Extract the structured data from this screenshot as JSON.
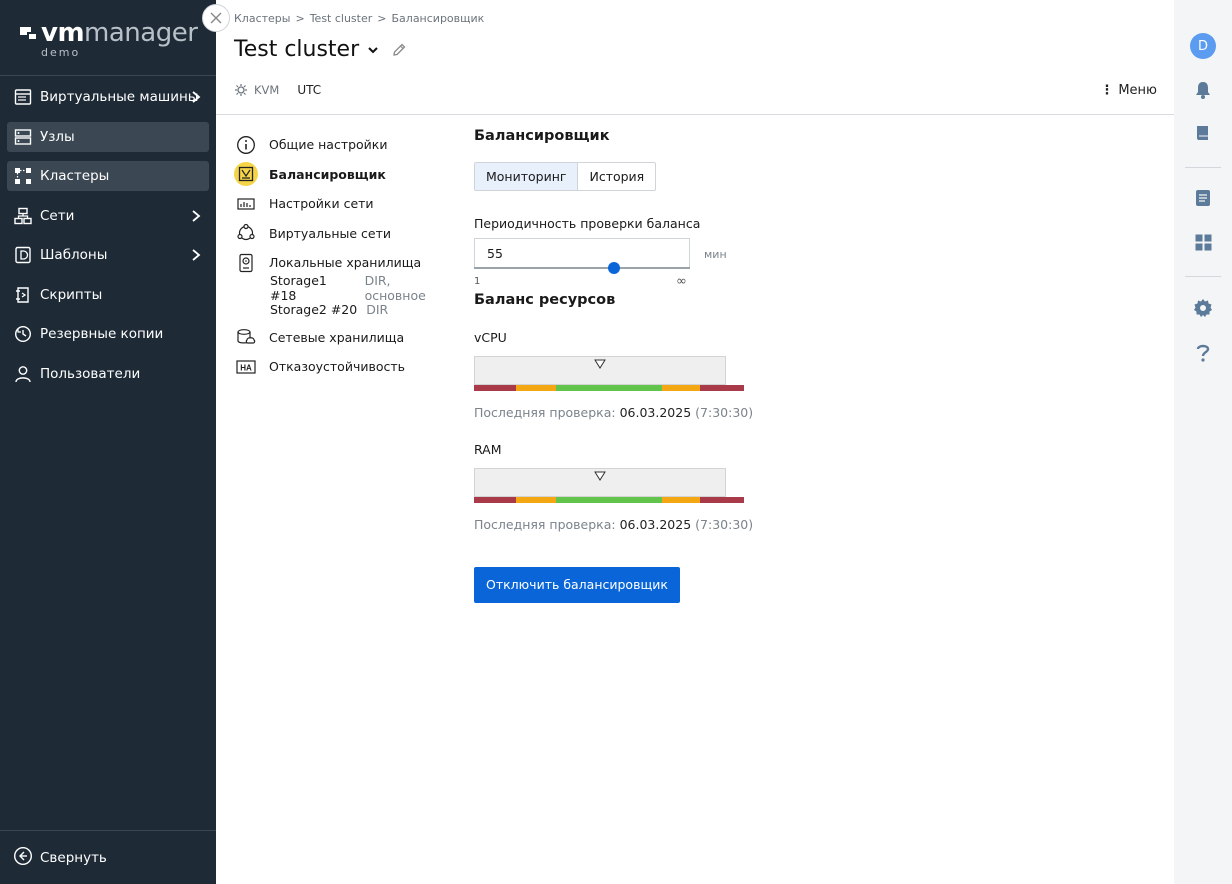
{
  "brand": {
    "vm": "vm",
    "manager": "manager",
    "subtitle": "demo"
  },
  "sidebar": {
    "items": [
      {
        "label": "Виртуальные машины",
        "icon": "vm-icon",
        "has_submenu": true,
        "active": false
      },
      {
        "label": "Узлы",
        "icon": "nodes-icon",
        "has_submenu": false,
        "active": true
      },
      {
        "label": "Кластеры",
        "icon": "clusters-icon",
        "has_submenu": false,
        "active": true
      },
      {
        "label": "Сети",
        "icon": "networks-icon",
        "has_submenu": true,
        "active": false
      },
      {
        "label": "Шаблоны",
        "icon": "templates-icon",
        "has_submenu": true,
        "active": false
      },
      {
        "label": "Скрипты",
        "icon": "scripts-icon",
        "has_submenu": false,
        "active": false
      },
      {
        "label": "Резервные копии",
        "icon": "backups-icon",
        "has_submenu": false,
        "active": false
      },
      {
        "label": "Пользователи",
        "icon": "users-icon",
        "has_submenu": false,
        "active": false
      }
    ],
    "collapse_label": "Свернуть"
  },
  "breadcrumb": [
    "Кластеры",
    "Test cluster",
    "Балансировщик"
  ],
  "breadcrumb_sep": ">",
  "header": {
    "title": "Test cluster",
    "virt_type": "KVM",
    "timezone": "UTC",
    "menu_label": "Меню"
  },
  "subnav": {
    "items": [
      {
        "label": "Общие настройки",
        "icon": "info-icon",
        "active": false
      },
      {
        "label": "Балансировщик",
        "icon": "balancer-icon",
        "active": true
      },
      {
        "label": "Настройки сети",
        "icon": "network-settings-icon",
        "active": false
      },
      {
        "label": "Виртуальные сети",
        "icon": "virtual-networks-icon",
        "active": false
      },
      {
        "label": "Локальные хранилища",
        "icon": "local-storage-icon",
        "active": false
      }
    ],
    "storages": [
      {
        "name": "Storage1 #18",
        "desc": "DIR, основное"
      },
      {
        "name": "Storage2 #20",
        "desc": "DIR"
      }
    ],
    "items_after": [
      {
        "label": "Сетевые хранилища",
        "icon": "network-storage-icon",
        "active": false
      },
      {
        "label": "Отказоустойчивость",
        "icon": "ha-icon",
        "active": false
      }
    ]
  },
  "balancer": {
    "title": "Балансировщик",
    "tabs": [
      {
        "label": "Мониторинг",
        "active": true
      },
      {
        "label": "История",
        "active": false
      }
    ],
    "interval_label": "Периодичность проверки баланса",
    "interval_value": "55",
    "interval_unit": "мин",
    "interval_min": "1",
    "interval_max": "∞",
    "interval_position": 0.65,
    "resources_title": "Баланс ресурсов",
    "resources": [
      {
        "name": "vCPU",
        "marker_position": 0.5,
        "check_label": "Последняя проверка:",
        "check_date": "06.03.2025",
        "check_time": "(7:30:30)"
      },
      {
        "name": "RAM",
        "marker_position": 0.5,
        "check_label": "Последняя проверка:",
        "check_date": "06.03.2025",
        "check_time": "(7:30:30)"
      }
    ],
    "gauge_colors": [
      "#a83a4a",
      "#f3a712",
      "#62c44a",
      "#f3a712",
      "#a83a4a"
    ],
    "disable_button": "Отключить балансировщик"
  },
  "right_rail": {
    "avatar_letter": "D",
    "avatar_color": "#5b9bf0",
    "icons": [
      "notifications-icon",
      "docs-icon",
      "tasks-icon",
      "dashboard-icon",
      "settings-icon",
      "help-icon"
    ]
  },
  "colors": {
    "sidebar_bg": "#1e2a36",
    "primary": "#0a66d8",
    "active_subnav": "#f5d547",
    "rail_icon": "#5c7a99"
  }
}
